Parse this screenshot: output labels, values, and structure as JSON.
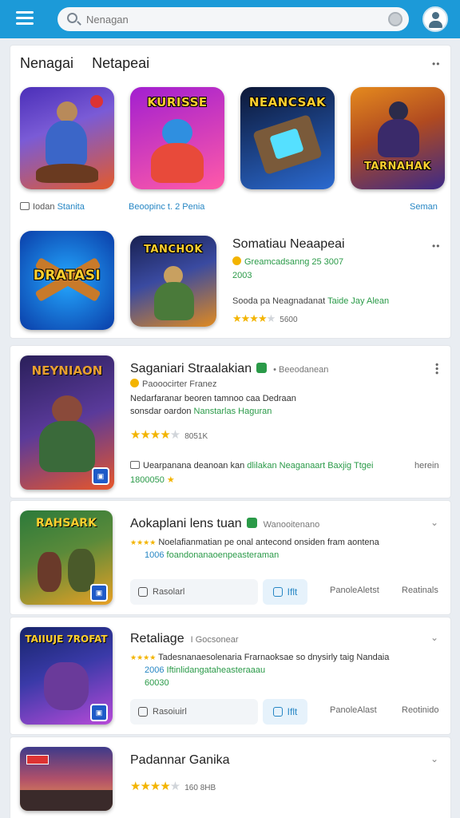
{
  "search": {
    "placeholder": "Nenagan"
  },
  "featured": {
    "tabs": [
      "Nenagai",
      "Netapeai"
    ],
    "more": "••",
    "icons": [
      {
        "label": "",
        "colors": [
          "#4b2fb8",
          "#e35a2a"
        ]
      },
      {
        "label": "KURISSE",
        "colors": [
          "#a21fd0",
          "#ff5aa8"
        ]
      },
      {
        "label": "NEANCSAK",
        "colors": [
          "#0c1736",
          "#2b6ad0"
        ]
      },
      {
        "label": "TARNAHAK",
        "colors": [
          "#e58a1e",
          "#3c2a88"
        ]
      },
      {
        "label": "DRATASI",
        "colors": [
          "#0a3da8",
          "#24a8ff"
        ]
      },
      {
        "label": "TANCHOK",
        "colors": [
          "#182050",
          "#e08a20"
        ]
      }
    ],
    "captions": [
      {
        "prefix": "Iodan",
        "link": "Stanita"
      },
      {
        "prefix": "",
        "link": "Beoopinc t. 2 Penia"
      },
      {
        "prefix": "",
        "link": "Seman"
      }
    ],
    "detail": {
      "title": "Somatiau Neaapeai",
      "more": "••",
      "line1": "Greamcadsanng 25 3007",
      "line2": "2003",
      "line3_prefix": "Sooda pa Neagnadanat",
      "line3_green": "Taide Jay Alean",
      "rating_text": "5600"
    }
  },
  "apps": [
    {
      "name": "Saganiari Straalakian",
      "sub": "• Beeodanean",
      "developer": "Paooocirter Franez",
      "desc1": "Nedarfaranar beoren tamnoo caa Dedraan",
      "desc2_prefix": "sonsdar oardon",
      "desc2_green": "Nanstarlas Haguran",
      "rating_text": "8051K",
      "footer_prefix": "Uearpanana deanoan kan",
      "footer_green": "dlilakan Neaganaart Baxjig Ttgei",
      "footer_right": "herein",
      "footer2": "1800050",
      "thumb_label": "NEYNIAON",
      "thumb_colors": [
        "#2a1f5a",
        "#e7562a"
      ]
    },
    {
      "name": "Aokaplani lens tuan",
      "sub": "Wanooitenano",
      "desc1": "Noelafianmatian pe onal antecond onsiden fram aontena",
      "desc2_blue": "1006",
      "desc2_green": "foandonanaoenpeasteraman",
      "action_label": "Rasolarl",
      "action_blue": "Iflt",
      "link1": "PanoleAletst",
      "link2": "Reatinals",
      "thumb_label": "RAHSARK",
      "thumb_colors": [
        "#2c7a3a",
        "#e8a024"
      ]
    },
    {
      "name": "Retaliage",
      "sub": "I Gocsonear",
      "desc1": "Tadesnanaesolenaria Frarnaoksae so dnysirly taig Nandaia",
      "desc2_blue": "2006",
      "desc2_green": "Iftinlidangataheasteraaau",
      "desc3": "60030",
      "action_label": "Rasoiuirl",
      "action_blue": "Iflt",
      "link1": "PanoleAlast",
      "link2": "Reotinido",
      "thumb_label": "TAIIUJE 7ROFAT",
      "thumb_colors": [
        "#16246a",
        "#b74ad8"
      ]
    },
    {
      "name": "Padannar Ganika",
      "rating_text": "160 8HB",
      "thumb_label": "",
      "thumb_colors": [
        "#3e3a8a",
        "#f2a24a"
      ]
    }
  ]
}
